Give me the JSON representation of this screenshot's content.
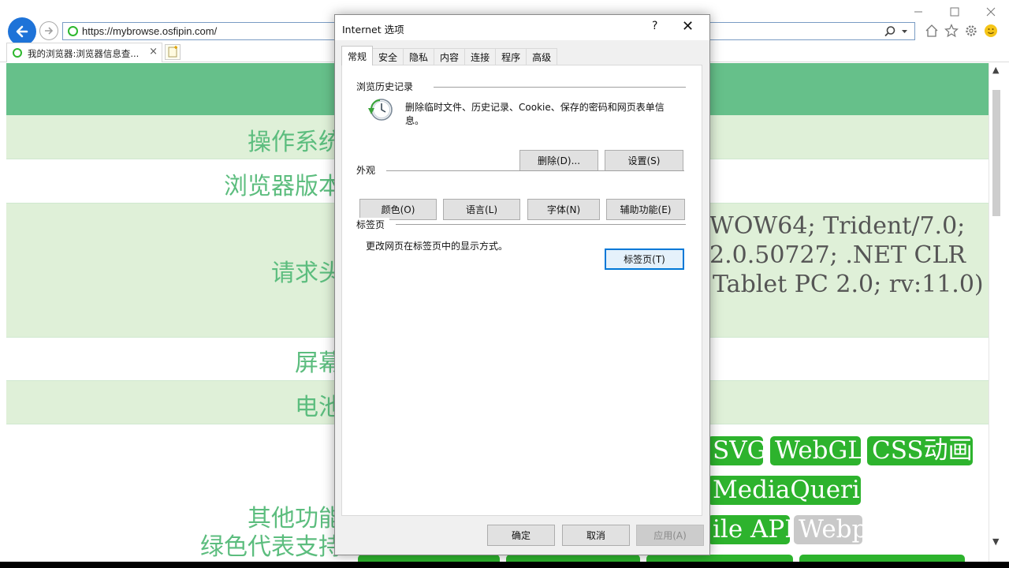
{
  "browser": {
    "url": "https://mybrowse.osfipin.com/",
    "tab_title": "我的浏览器:浏览器信息查...",
    "tab_close": "×"
  },
  "page": {
    "rows": [
      {
        "label": "操作系统",
        "value": ""
      },
      {
        "label": "浏览器版本",
        "value": ""
      },
      {
        "label": "请求头",
        "values": [
          "WOW64; Trident/7.0;",
          "2.0.50727; .NET CLR",
          "Tablet PC 2.0; rv:11.0)"
        ]
      },
      {
        "label": "屏幕",
        "value": ""
      },
      {
        "label": "电池",
        "value": ""
      },
      {
        "label": "其他功能",
        "label2": "绿色代表支持"
      }
    ],
    "features": [
      {
        "text": "SVG",
        "supported": true
      },
      {
        "text": "WebGL",
        "supported": true
      },
      {
        "text": "CSS动画",
        "supported": true
      },
      {
        "text": "MediaQueries",
        "supported": true
      },
      {
        "text": "ile API",
        "supported": true
      },
      {
        "text": "Webp",
        "supported": false
      },
      {
        "text": "",
        "supported": true
      },
      {
        "text": "",
        "supported": true
      },
      {
        "text": "",
        "supported": true
      },
      {
        "text": "",
        "supported": true
      }
    ]
  },
  "dialog": {
    "title": "Internet 选项",
    "help": "?",
    "close": "✕",
    "tabs": [
      "常规",
      "安全",
      "隐私",
      "内容",
      "连接",
      "程序",
      "高级"
    ],
    "history": {
      "heading": "浏览历史记录",
      "desc_line1": "删除临时文件、历史记录、Cookie、保存的密码和网页表单信",
      "desc_line2": "息。",
      "delete_btn": "删除(D)...",
      "settings_btn": "设置(S)"
    },
    "appearance": {
      "heading": "外观",
      "colors_btn": "颜色(O)",
      "language_btn": "语言(L)",
      "fonts_btn": "字体(N)",
      "accessibility_btn": "辅助功能(E)"
    },
    "tabsec": {
      "heading": "标签页",
      "desc": "更改网页在标签页中的显示方式。",
      "tabs_btn": "标签页(T)"
    },
    "ok_btn": "确定",
    "cancel_btn": "取消",
    "apply_btn": "应用(A)"
  },
  "colors": {
    "header_green": "#66c08a",
    "row_alt": "#dff0d8",
    "label_green": "#5cbd7e",
    "feature_green": "#2db32d",
    "feature_off": "#c9c9c9",
    "accent_blue": "#1e73d8"
  }
}
